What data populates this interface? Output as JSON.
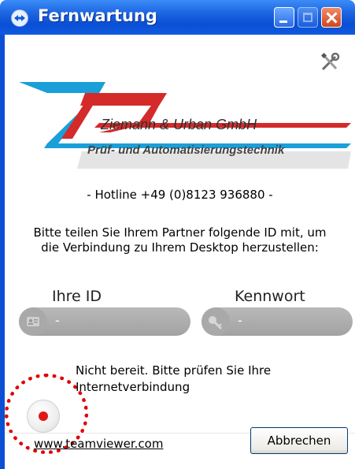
{
  "window": {
    "title": "Fernwartung"
  },
  "logo": {
    "company": "Ziemann & Urban GmbH",
    "subtitle": "Prüf- und Automatisierungstechnik"
  },
  "hotline": "- Hotline +49 (0)8123 936880 -",
  "info_text": "Bitte teilen Sie Ihrem Partner folgende ID mit, um die Verbindung zu Ihrem Desktop herzustellen:",
  "fields": {
    "id_label": "Ihre ID",
    "id_value": "-",
    "password_label": "Kennwort",
    "password_value": "-"
  },
  "status": {
    "text": "Nicht bereit. Bitte prüfen Sie Ihre Internetverbindung",
    "color": "#e01818"
  },
  "footer": {
    "link": "www.teamviewer.com",
    "cancel_label": "Abbrechen"
  },
  "colors": {
    "titlebar": "#0a4fd4",
    "highlight": "#e00000",
    "logo_blue": "#1a9fd8",
    "logo_red": "#d42a2a"
  }
}
